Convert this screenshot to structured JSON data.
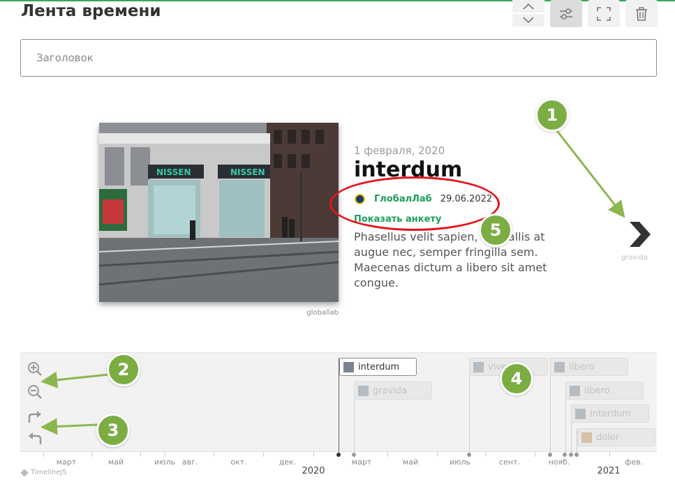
{
  "header": {
    "title": "Лента времени"
  },
  "title_field": {
    "placeholder": "Заголовок",
    "value": ""
  },
  "slide": {
    "photo_credit": "globallab",
    "date": "1 февраля, 2020",
    "headline": "interdum",
    "author_name": "ГлобалЛаб",
    "author_date": "29.06.2022",
    "show_profile": "Показать анкету",
    "text": "Phasellus velit sapien, convallis at augue nec, semper fringilla sem. Maecenas dictum a libero sit amet congue.",
    "next_label": "gravida",
    "photo_signs": [
      "NISSEN",
      "NISSEN"
    ]
  },
  "annotations": {
    "badges": [
      "1",
      "2",
      "3",
      "4",
      "5"
    ],
    "arrow_color": "#8cb64e",
    "badge_color": "#7cad43",
    "ellipse_color": "#e4141c"
  },
  "timeline": {
    "markers": [
      {
        "label": "interdum",
        "active": true
      },
      {
        "label": "gravida",
        "active": false
      },
      {
        "label": "viverra",
        "active": false
      },
      {
        "label": "libero",
        "active": false
      },
      {
        "label": "libero",
        "active": false
      },
      {
        "label": "interdum",
        "active": false
      },
      {
        "label": "dolor",
        "active": false
      }
    ],
    "months": [
      "март",
      "май",
      "июль",
      "авг.",
      "окт.",
      "дек.",
      "март",
      "май",
      "июль",
      "сент.",
      "нояб.",
      "фев."
    ],
    "years": [
      "2020",
      "2021"
    ],
    "brand": "TimelineJS"
  },
  "colors": {
    "accent_green": "#1a9e5a",
    "top_bar": "#3aa55a"
  }
}
